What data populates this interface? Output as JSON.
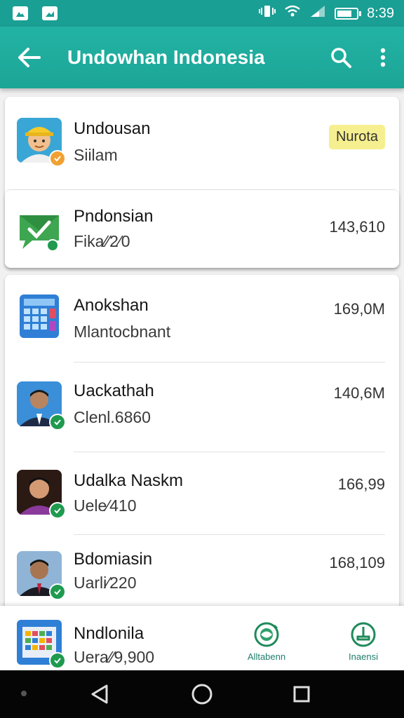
{
  "status_bar": {
    "time": "8:39",
    "icons": [
      "image-icon",
      "photo-icon",
      "vibrate-icon",
      "wifi-icon",
      "signal-icon",
      "battery-icon"
    ]
  },
  "app_bar": {
    "title": "Undowhan Indonesia",
    "icons": [
      "back-arrow-icon",
      "search-icon",
      "more-vert-icon"
    ]
  },
  "list": {
    "items": [
      {
        "name": "Undousan",
        "sub": "Siilam",
        "tag": "Nurota",
        "avatar": "worker-avatar"
      },
      {
        "name": "Pndonsian",
        "sub": "Fika⁄⁄2⁄0",
        "value": "143,610",
        "avatar": "message-check-icon"
      },
      {
        "name": "Anokshan",
        "sub": "Mlantocbnant",
        "value": "169,0M",
        "avatar": "calculator-icon"
      },
      {
        "name": "Uackathah",
        "sub": "Clenl.6860",
        "value": "140,6M",
        "avatar": "person-avatar"
      },
      {
        "name": "Udalka Naskm",
        "sub": "Uele⁄410",
        "value": "166,99",
        "avatar": "person-avatar"
      },
      {
        "name": "Bdomiasin",
        "sub": "Uarli⁄220",
        "value": "168,109",
        "avatar": "person-avatar"
      }
    ]
  },
  "bottom_bar": {
    "item": {
      "name": "Nndlonila",
      "sub": "Uera⁄⁄9,900",
      "avatar": "calendar-grid-icon"
    },
    "actions": [
      {
        "label": "Alltabenn",
        "icon": "globe-hand-icon"
      },
      {
        "label": "Inaensi",
        "icon": "stand-icon"
      }
    ]
  },
  "colors": {
    "primary": "#1ca597",
    "tag_bg": "#f6ef8f",
    "badge": "#1f9a4f"
  }
}
